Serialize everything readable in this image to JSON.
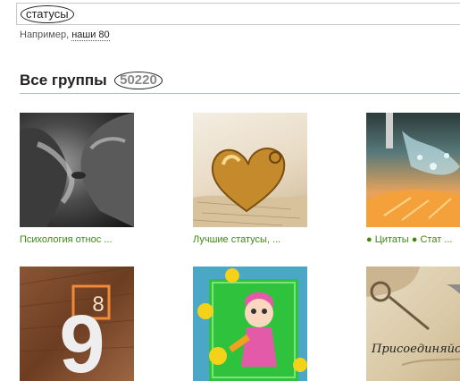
{
  "search": {
    "value": "статусы"
  },
  "hint": {
    "prefix": "Например,",
    "link": "наши 80"
  },
  "section": {
    "title": "Все группы",
    "count": "50220"
  },
  "groups": [
    {
      "label": "Психология относ ..."
    },
    {
      "label": "Лучшие статусы, ..."
    },
    {
      "label": "● Цитаты ● Стат ..."
    },
    {
      "label": ""
    },
    {
      "label": ""
    },
    {
      "label": ""
    }
  ],
  "thumb_text": {
    "nine": "9",
    "eight": "8",
    "vintage_caption": "Присоединяйс"
  }
}
